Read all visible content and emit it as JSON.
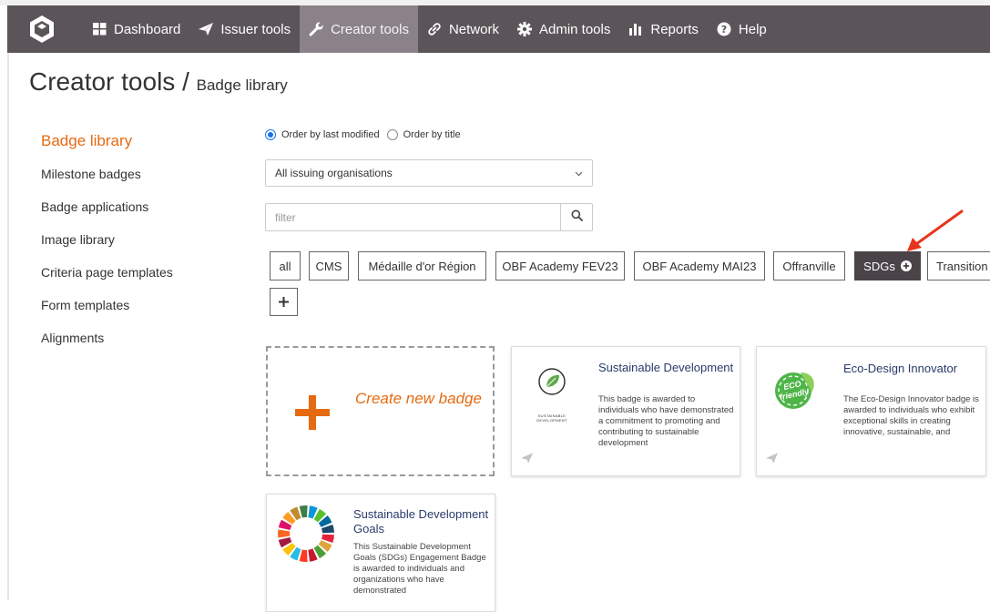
{
  "nav": {
    "items": [
      {
        "label": "Dashboard",
        "icon": "grid-icon"
      },
      {
        "label": "Issuer tools",
        "icon": "paper-plane-icon"
      },
      {
        "label": "Creator tools",
        "icon": "wrench-icon"
      },
      {
        "label": "Network",
        "icon": "link-icon"
      },
      {
        "label": "Admin tools",
        "icon": "gear-icon"
      },
      {
        "label": "Reports",
        "icon": "bar-chart-icon"
      },
      {
        "label": "Help",
        "icon": "question-icon"
      }
    ]
  },
  "page": {
    "title": "Creator tools /",
    "subtitle": "Badge library"
  },
  "sidebar": {
    "items": [
      {
        "label": "Badge library"
      },
      {
        "label": "Milestone badges"
      },
      {
        "label": "Badge applications"
      },
      {
        "label": "Image library"
      },
      {
        "label": "Criteria page templates"
      },
      {
        "label": "Form templates"
      },
      {
        "label": "Alignments"
      }
    ]
  },
  "order": {
    "last_modified": "Order by last modified",
    "title": "Order by title"
  },
  "org_select": {
    "value": "All issuing organisations"
  },
  "filter": {
    "placeholder": "filter"
  },
  "tags": [
    "all",
    "CMS",
    "Médaille d'or Région",
    "OBF Academy FEV23",
    "OBF Academy MAI23",
    "Offranville",
    "SDGs",
    "Transition"
  ],
  "create": {
    "label": "Create new badge"
  },
  "cards": [
    {
      "title": "Sustainable Development",
      "logo_text": "SUSTAINABLE DEVELOPMENT",
      "description": "This badge is awarded to individuals who have demonstrated a commitment to promoting and contributing to sustainable development"
    },
    {
      "title": "Eco-Design Innovator",
      "logo_text": "ECO friendly",
      "description": "The Eco-Design Innovator badge is awarded to individuals who exhibit exceptional skills in creating innovative, sustainable, and"
    },
    {
      "title": "Sustainable Development Goals",
      "description": "This Sustainable Development Goals (SDGs) Engagement Badge is awarded to individuals and organizations who have demonstrated"
    }
  ],
  "colors": {
    "nav_bg": "#5b5459",
    "nav_active": "#8a8288",
    "accent": "#e66a12",
    "card_title": "#2a3b6b",
    "tag_selected": "#4a4348",
    "annotation_arrow": "#e8341c"
  }
}
